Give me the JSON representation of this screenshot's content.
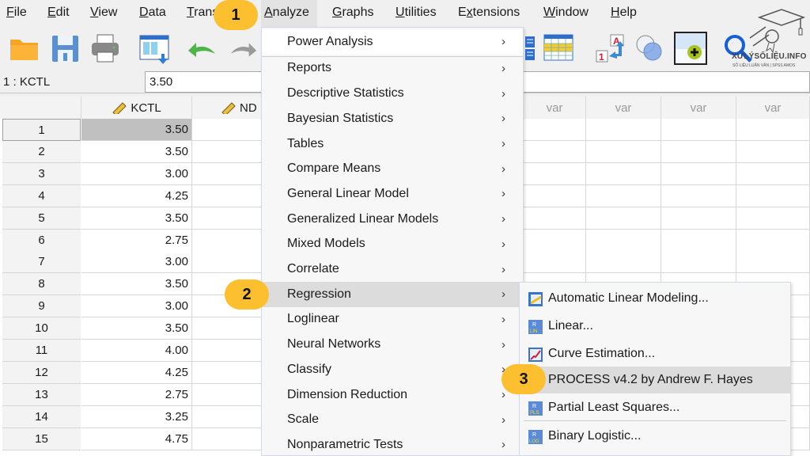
{
  "menubar": {
    "items": [
      {
        "label": "File",
        "mnemonic": "F"
      },
      {
        "label": "Edit",
        "mnemonic": "E"
      },
      {
        "label": "View",
        "mnemonic": "V"
      },
      {
        "label": "Data",
        "mnemonic": "D"
      },
      {
        "label": "Trans",
        "mnemonic": "T"
      },
      {
        "label": "Analyze",
        "mnemonic": "A"
      },
      {
        "label": "Graphs",
        "mnemonic": "G"
      },
      {
        "label": "Utilities",
        "mnemonic": "U"
      },
      {
        "label": "Extensions",
        "mnemonic": "x"
      },
      {
        "label": "Window",
        "mnemonic": "W"
      },
      {
        "label": "Help",
        "mnemonic": "H"
      }
    ],
    "active": "Analyze"
  },
  "toolbar": {
    "icons": [
      "open-folder-icon",
      "save-disk-icon",
      "print-icon",
      "recall-dialog-icon",
      "undo-icon",
      "redo-icon",
      "split-file-icon",
      "select-cases-icon",
      "value-labels-icon",
      "use-sets-icon",
      "insert-variable-icon",
      "search-icon"
    ]
  },
  "cellref": {
    "label": "1 : KCTL",
    "value": "3.50"
  },
  "grid": {
    "columns": [
      "KCTL",
      "ND",
      "var",
      "var",
      "var",
      "var"
    ],
    "rows": [
      {
        "n": "1",
        "KCTL": "3.50"
      },
      {
        "n": "2",
        "KCTL": "3.50"
      },
      {
        "n": "3",
        "KCTL": "3.00"
      },
      {
        "n": "4",
        "KCTL": "4.25"
      },
      {
        "n": "5",
        "KCTL": "3.50"
      },
      {
        "n": "6",
        "KCTL": "2.75"
      },
      {
        "n": "7",
        "KCTL": "3.00"
      },
      {
        "n": "8",
        "KCTL": "3.50"
      },
      {
        "n": "9",
        "KCTL": "3.00"
      },
      {
        "n": "10",
        "KCTL": "3.50"
      },
      {
        "n": "11",
        "KCTL": "4.00"
      },
      {
        "n": "12",
        "KCTL": "4.25"
      },
      {
        "n": "13",
        "KCTL": "2.75"
      },
      {
        "n": "14",
        "KCTL": "3.25"
      },
      {
        "n": "15",
        "KCTL": "4.75"
      }
    ],
    "selected_row": 1,
    "selected_column": "KCTL"
  },
  "analyze_menu": {
    "items": [
      {
        "label": "Power Analysis",
        "submenu": true
      },
      {
        "label": "Reports",
        "submenu": true
      },
      {
        "label": "Descriptive Statistics",
        "submenu": true
      },
      {
        "label": "Bayesian Statistics",
        "submenu": true
      },
      {
        "label": "Tables",
        "submenu": true
      },
      {
        "label": "Compare Means",
        "submenu": true
      },
      {
        "label": "General Linear Model",
        "submenu": true
      },
      {
        "label": "Generalized Linear Models",
        "submenu": true
      },
      {
        "label": "Mixed Models",
        "submenu": true
      },
      {
        "label": "Correlate",
        "submenu": true
      },
      {
        "label": "Regression",
        "submenu": true,
        "highlighted": true
      },
      {
        "label": "Loglinear",
        "submenu": true
      },
      {
        "label": "Neural Networks",
        "submenu": true
      },
      {
        "label": "Classify",
        "submenu": true
      },
      {
        "label": "Dimension Reduction",
        "submenu": true
      },
      {
        "label": "Scale",
        "submenu": true
      },
      {
        "label": "Nonparametric Tests",
        "submenu": true
      }
    ],
    "arrow": "›"
  },
  "regression_menu": {
    "items": [
      {
        "label": "Automatic Linear Modeling...",
        "icon": "automatic-linear-modeling-icon"
      },
      {
        "label": "Linear...",
        "icon": "linear-regression-icon"
      },
      {
        "label": "Curve Estimation...",
        "icon": "curve-estimation-icon"
      },
      {
        "label": "PROCESS v4.2 by Andrew F. Hayes",
        "icon": "",
        "highlighted": true
      },
      {
        "label": "Partial Least Squares...",
        "icon": "partial-least-squares-icon"
      },
      {
        "label": "Binary Logistic...",
        "icon": "binary-logistic-icon"
      }
    ]
  },
  "badges": [
    "1",
    "2",
    "3"
  ],
  "logo": {
    "title": "XỬLÝSỐLIỆU.INFO",
    "subtitle": "SỐ LIỆU LUẬN VĂN | SPSS AMOS"
  },
  "colors": {
    "badge": "#fbbf2f",
    "menu_highlight": "#dcdcdc",
    "selected_cell": "#c0c0c0"
  }
}
